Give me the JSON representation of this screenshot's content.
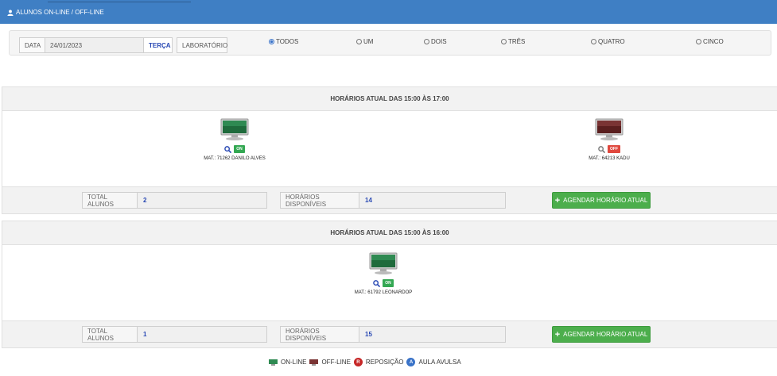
{
  "header": {
    "title": "ALUNOS ON-LINE / OFF-LINE",
    "icon": "user-icon"
  },
  "filters": {
    "date_label": "DATA",
    "date_value": "24/01/2023",
    "weekday": "TERÇA",
    "lab_label": "LABORATÓRIO",
    "options": [
      {
        "label": "TODOS",
        "checked": true
      },
      {
        "label": "UM",
        "checked": false
      },
      {
        "label": "DOIS",
        "checked": false
      },
      {
        "label": "TRÊS",
        "checked": false
      },
      {
        "label": "QUATRO",
        "checked": false
      },
      {
        "label": "CINCO",
        "checked": false
      }
    ]
  },
  "sections": [
    {
      "title": "HORÁRIOS ATUAL DAS 15:00 ÀS 17:00",
      "students": [
        {
          "status": "ON",
          "mat": "MAT.: 71262 DANILO ALVES"
        },
        {
          "status": "OFF",
          "mat": "MAT.: 64213 KADU"
        }
      ],
      "total_label": "TOTAL ALUNOS",
      "total_value": "2",
      "avail_label": "HORÁRIOS DISPONÍVEIS",
      "avail_value": "14",
      "button_label": "AGENDAR HORÁRIO ATUAL"
    },
    {
      "title": "HORÁRIOS ATUAL DAS 15:00 ÀS 16:00",
      "students": [
        {
          "status": "ON",
          "mat": "MAT.: 61792 LEONARDOP"
        }
      ],
      "total_label": "TOTAL ALUNOS",
      "total_value": "1",
      "avail_label": "HORÁRIOS DISPONÍVEIS",
      "avail_value": "15",
      "button_label": "AGENDAR HORÁRIO ATUAL"
    }
  ],
  "legend": {
    "online": "ON-LINE",
    "offline": "OFF-LINE",
    "reposicao_letter": "R",
    "reposicao": "REPOSIÇÃO",
    "avulsa_letter": "A",
    "avulsa": "AULA AVULSA"
  },
  "colors": {
    "header_bg": "#3f7fc4",
    "on": "#34a853",
    "off": "#e0483e",
    "button": "#4cae4c",
    "link_blue": "#2747b3",
    "reposicao": "#c62828",
    "avulsa": "#3a73c8"
  }
}
